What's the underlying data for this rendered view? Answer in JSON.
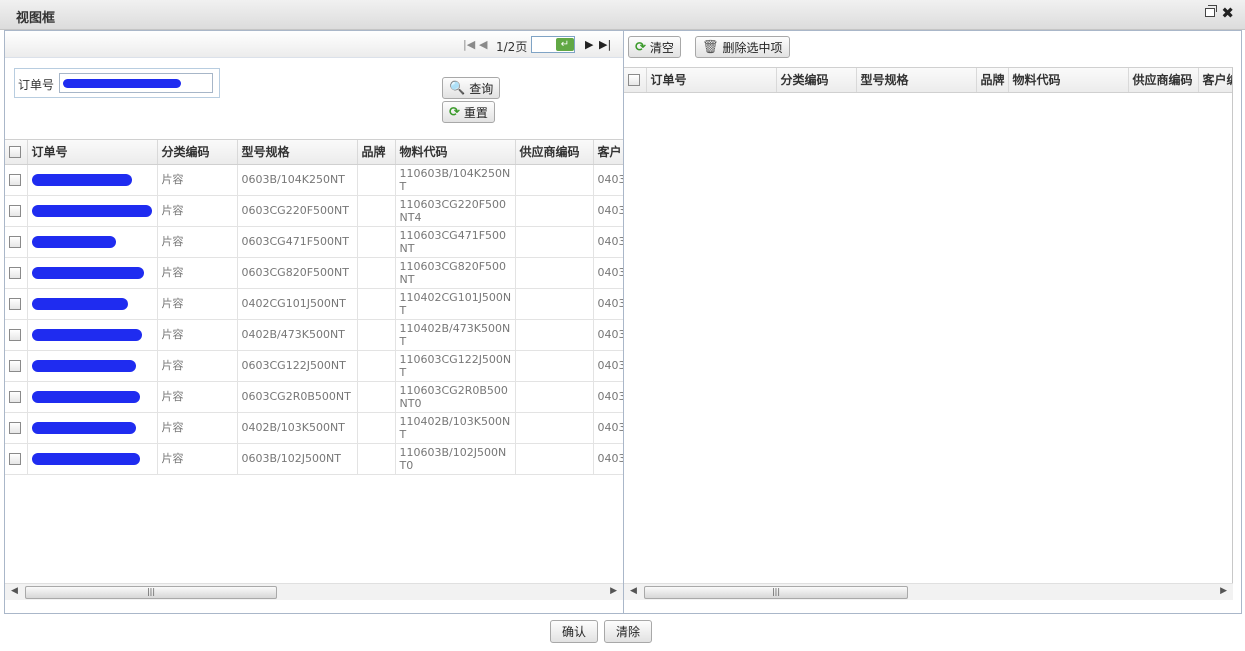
{
  "window": {
    "title": "视图框"
  },
  "left": {
    "pager": {
      "page_info": "1/2页",
      "page_input": ""
    },
    "search": {
      "label": "订单号",
      "value": ""
    },
    "buttons": {
      "query": "查询",
      "reset": "重置"
    },
    "columns": [
      "订单号",
      "分类编码",
      "型号规格",
      "品牌",
      "物料代码",
      "供应商编码",
      "客户"
    ],
    "rows": [
      {
        "order": "",
        "category": "片容",
        "model": "0603B/104K250NT",
        "brand": "",
        "material": "110603B/104K250NT",
        "supplier": "",
        "customer": "0403"
      },
      {
        "order": "",
        "category": "片容",
        "model": "0603CG220F500NT",
        "brand": "",
        "material": "110603CG220F500NT4",
        "supplier": "",
        "customer": "0403"
      },
      {
        "order": "",
        "category": "片容",
        "model": "0603CG471F500NT",
        "brand": "",
        "material": "110603CG471F500NT",
        "supplier": "",
        "customer": "0403"
      },
      {
        "order": "",
        "category": "片容",
        "model": "0603CG820F500NT",
        "brand": "",
        "material": "110603CG820F500NT",
        "supplier": "",
        "customer": "0403"
      },
      {
        "order": "",
        "category": "片容",
        "model": "0402CG101J500NT",
        "brand": "",
        "material": "110402CG101J500NT",
        "supplier": "",
        "customer": "0403"
      },
      {
        "order": "",
        "category": "片容",
        "model": "0402B/473K500NT",
        "brand": "",
        "material": "110402B/473K500NT",
        "supplier": "",
        "customer": "0403"
      },
      {
        "order": "",
        "category": "片容",
        "model": "0603CG122J500NT",
        "brand": "",
        "material": "110603CG122J500NT",
        "supplier": "",
        "customer": "0403"
      },
      {
        "order": "",
        "category": "片容",
        "model": "0603CG2R0B500NT",
        "brand": "",
        "material": "110603CG2R0B500NT0",
        "supplier": "",
        "customer": "0403"
      },
      {
        "order": "",
        "category": "片容",
        "model": "0402B/103K500NT",
        "brand": "",
        "material": "110402B/103K500NT",
        "supplier": "",
        "customer": "0403"
      },
      {
        "order": "",
        "category": "片容",
        "model": "0603B/102J500NT",
        "brand": "",
        "material": "110603B/102J500NT0",
        "supplier": "",
        "customer": "0403"
      }
    ]
  },
  "right": {
    "buttons": {
      "clear": "清空",
      "delete_selected": "删除选中项"
    },
    "columns": [
      "订单号",
      "分类编码",
      "型号规格",
      "品牌",
      "物料代码",
      "供应商编码",
      "客户编"
    ]
  },
  "footer": {
    "confirm": "确认",
    "clear": "清除"
  },
  "colors": {
    "accent_blue": "#1f2cf0",
    "border": "#aab7c9",
    "go_green": "#61a845"
  }
}
